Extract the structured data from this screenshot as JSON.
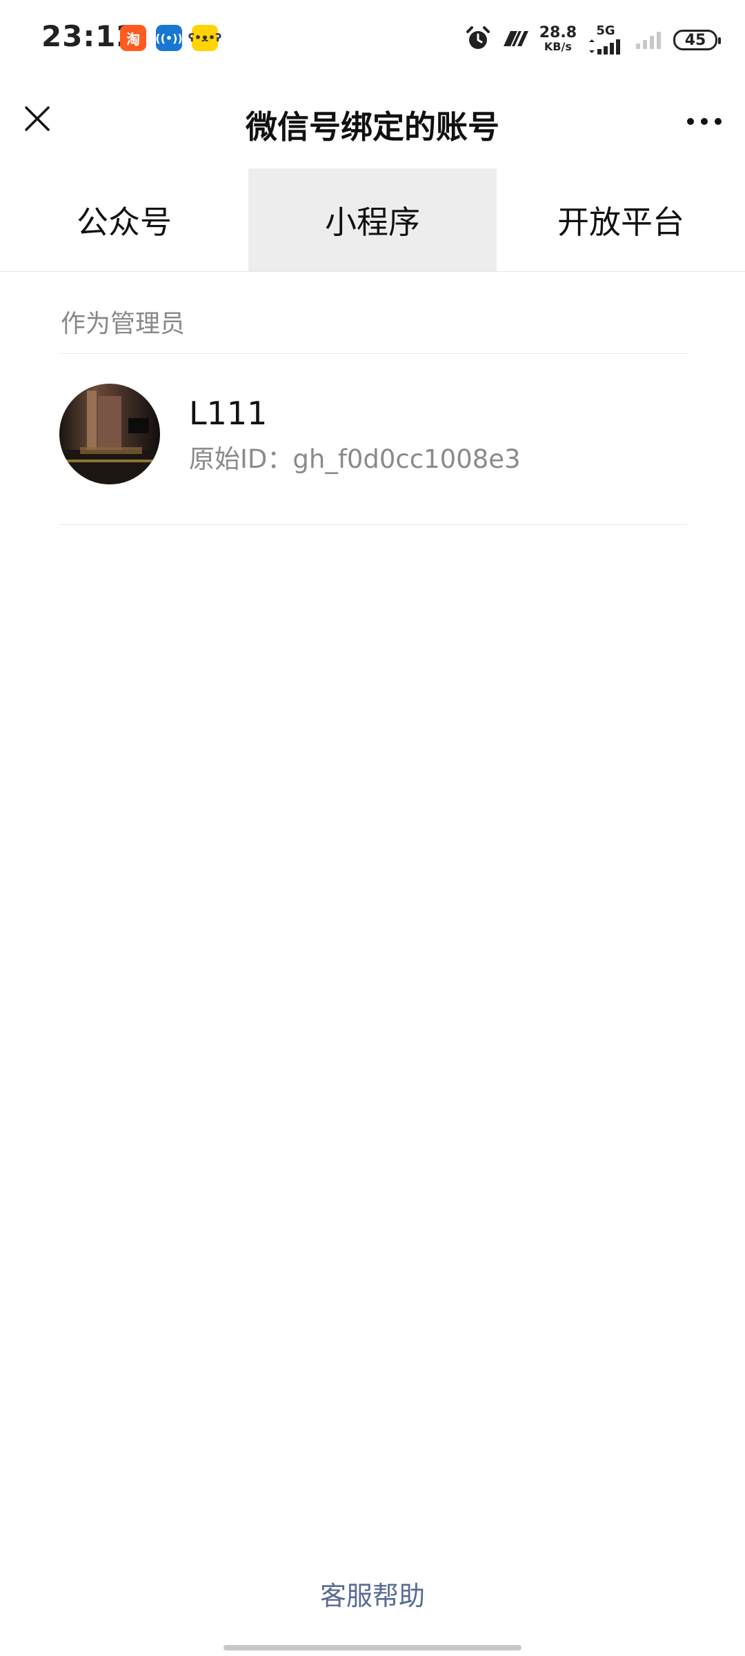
{
  "status_bar": {
    "time": "23:12",
    "apps": [
      {
        "icon": "taobao-icon",
        "glyph": "淘"
      },
      {
        "icon": "hotspot-icon",
        "glyph": "((•))"
      },
      {
        "icon": "bear-app-icon",
        "glyph": "ʕ•ᴥ•ʔ"
      }
    ],
    "speed_value": "28.8",
    "speed_unit": "KB/s",
    "network_type": "5G",
    "battery": "45"
  },
  "header": {
    "title": "微信号绑定的账号"
  },
  "tabs": [
    {
      "label": "公众号",
      "active": false
    },
    {
      "label": "小程序",
      "active": true
    },
    {
      "label": "开放平台",
      "active": false
    }
  ],
  "section": {
    "label": "作为管理员"
  },
  "accounts": [
    {
      "name": "L111",
      "original_id": "原始ID：gh_f0d0cc1008e3"
    }
  ],
  "footer": {
    "help_label": "客服帮助"
  }
}
